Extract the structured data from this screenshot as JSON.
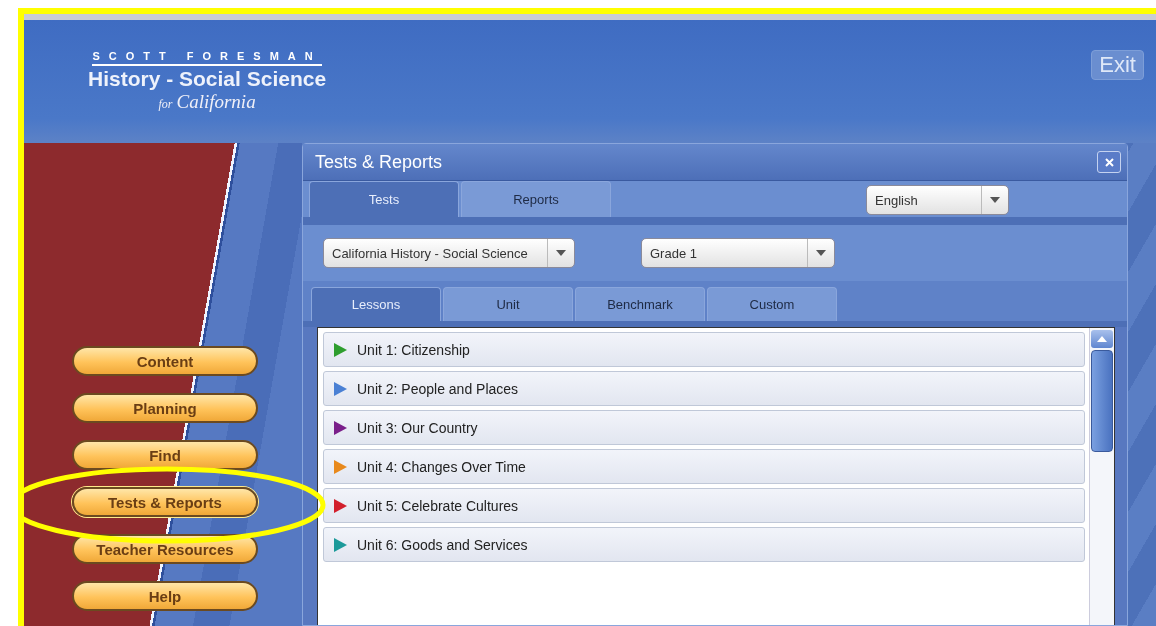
{
  "logo": {
    "brand": "SCOTT FORESMAN",
    "title": "History - Social Science",
    "subtitle_prefix": "for",
    "subtitle": "California"
  },
  "exit_button": "Exit",
  "nav_buttons": [
    {
      "label": "Content",
      "highlighted": false
    },
    {
      "label": "Planning",
      "highlighted": false
    },
    {
      "label": "Find",
      "highlighted": false
    },
    {
      "label": "Tests & Reports",
      "highlighted": true
    },
    {
      "label": "Teacher Resources",
      "highlighted": false
    },
    {
      "label": "Help",
      "highlighted": false
    }
  ],
  "dialog": {
    "title": "Tests & Reports",
    "tabs": [
      {
        "label": "Tests",
        "selected": true
      },
      {
        "label": "Reports",
        "selected": false
      }
    ],
    "language": {
      "value": "English"
    },
    "subject": {
      "value": "California History - Social Science"
    },
    "grade": {
      "value": "Grade 1"
    },
    "subtabs": [
      {
        "label": "Lessons",
        "selected": true
      },
      {
        "label": "Unit",
        "selected": false
      },
      {
        "label": "Benchmark",
        "selected": false
      },
      {
        "label": "Custom",
        "selected": false
      }
    ],
    "units": [
      {
        "label": "Unit 1: Citizenship",
        "color": "#2e9e2e"
      },
      {
        "label": "Unit 2: People and Places",
        "color": "#4a80d4"
      },
      {
        "label": "Unit 3: Our Country",
        "color": "#7a1f8a"
      },
      {
        "label": "Unit 4: Changes Over Time",
        "color": "#e8891c"
      },
      {
        "label": "Unit 5: Celebrate Cultures",
        "color": "#d21f2c"
      },
      {
        "label": "Unit 6: Goods and Services",
        "color": "#1c9a9a"
      }
    ]
  }
}
